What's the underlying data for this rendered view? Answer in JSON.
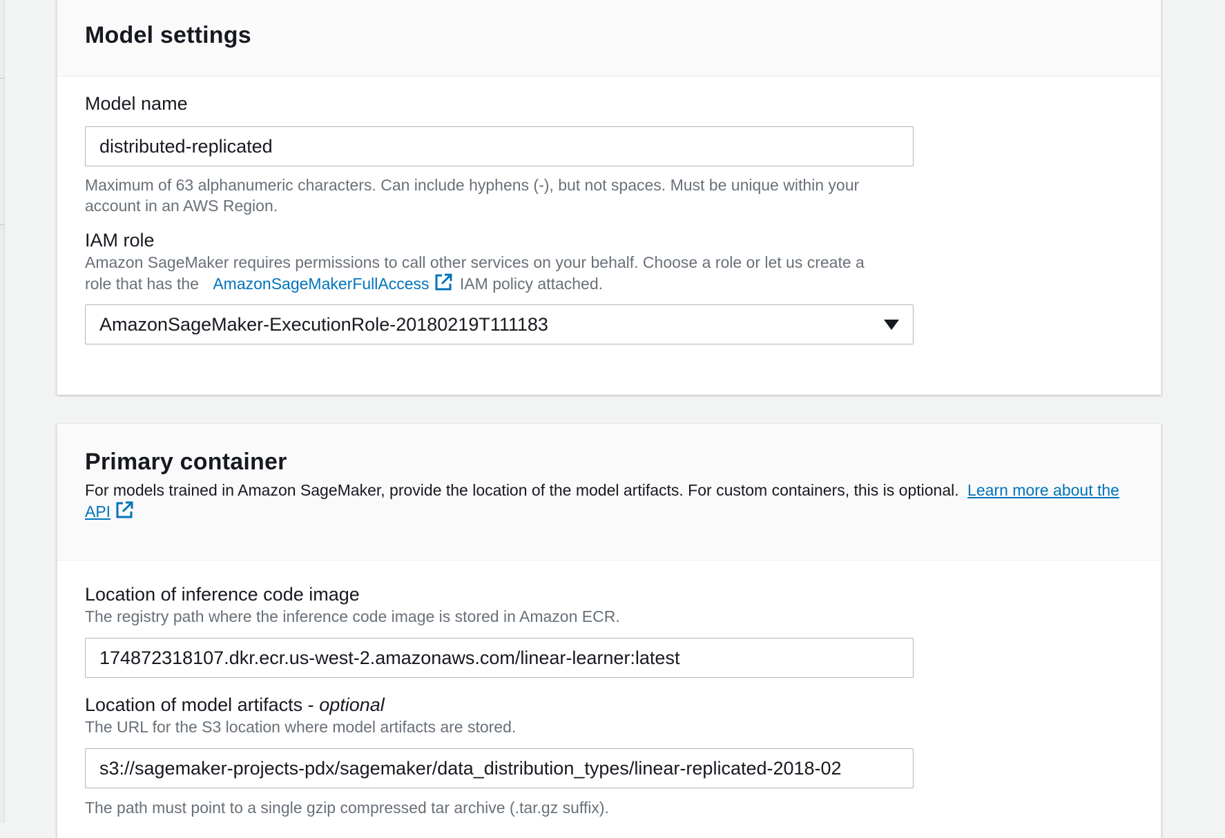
{
  "model_settings": {
    "title": "Model settings",
    "model_name": {
      "label": "Model name",
      "value": "distributed-replicated",
      "hint_line1": "Maximum of 63 alphanumeric characters. Can include hyphens (-), but not spaces. Must be unique within your",
      "hint_line2": "account in an AWS Region."
    },
    "iam_role": {
      "label": "IAM role",
      "desc_line1": "Amazon SageMaker requires permissions to call other services on your behalf. Choose a role or let us create a",
      "desc_prefix": "role that has the",
      "policy_link": "AmazonSageMakerFullAccess",
      "desc_suffix": "IAM policy attached.",
      "selected_value": "AmazonSageMaker-ExecutionRole-20180219T111183"
    }
  },
  "primary_container": {
    "title": "Primary container",
    "desc_line1": "For models trained in Amazon SageMaker, provide the location of the model artifacts. For custom containers, this is optional.",
    "learn_more_part1": "Learn more",
    "learn_more_part2": "about the API",
    "inference_image": {
      "label": "Location of inference code image",
      "desc": "The registry path where the inference code image is stored in Amazon ECR.",
      "value": "174872318107.dkr.ecr.us-west-2.amazonaws.com/linear-learner:latest"
    },
    "model_artifacts": {
      "label": "Location of model artifacts -",
      "label_optional": "optional",
      "desc": "The URL for the S3 location where model artifacts are stored.",
      "value": "s3://sagemaker-projects-pdx/sagemaker/data_distribution_types/linear-replicated-2018-02",
      "footer_hint": "The path must point to a single gzip compressed tar archive (.tar.gz suffix)."
    }
  },
  "colors": {
    "link": "#0073bb",
    "hint_text": "#687078",
    "border": "#aab7b8",
    "page_background": "#f2f3f3"
  },
  "icons": {
    "external_link": "external-link-icon",
    "dropdown": "caret-down-icon"
  }
}
